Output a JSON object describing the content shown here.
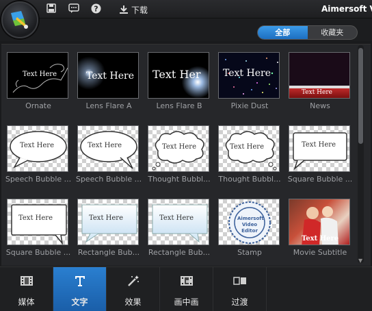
{
  "toolbar": {
    "download_label": "下载",
    "app_title": "Aimersoft V"
  },
  "filter_tabs": [
    {
      "label": "全部",
      "active": true
    },
    {
      "label": "收藏夹",
      "active": false
    }
  ],
  "templates": [
    {
      "label": "Ornate",
      "sample_text": "Text Here"
    },
    {
      "label": "Lens Flare A",
      "sample_text": "Text Here"
    },
    {
      "label": "Lens Flare B",
      "sample_text": "Text Her"
    },
    {
      "label": "Pixie Dust",
      "sample_text": "Text Here"
    },
    {
      "label": "News",
      "sample_text": "Text Here"
    },
    {
      "label": "Speech Bubble ...",
      "sample_text": "Text Here"
    },
    {
      "label": "Speech Bubble ...",
      "sample_text": "Text Here"
    },
    {
      "label": "Thought Bubbl...",
      "sample_text": "Text Here"
    },
    {
      "label": "Thought Bubbl...",
      "sample_text": "Text Here"
    },
    {
      "label": "Square Bubble ...",
      "sample_text": "Text Here"
    },
    {
      "label": "Square Bubble ...",
      "sample_text": "Text Here"
    },
    {
      "label": "Rectangle Bub...",
      "sample_text": "Text Here"
    },
    {
      "label": "Rectangle Bub...",
      "sample_text": "Text Here"
    },
    {
      "label": "Stamp",
      "sample_text": "Aimersoft Video Editor"
    },
    {
      "label": "Movie Subtitle",
      "sample_text": "Text Here"
    }
  ],
  "bottom_nav": [
    {
      "label": "媒体",
      "icon": "film-icon",
      "active": false
    },
    {
      "label": "文字",
      "icon": "text-icon",
      "active": true
    },
    {
      "label": "效果",
      "icon": "magic-wand-icon",
      "active": false
    },
    {
      "label": "画中画",
      "icon": "pip-icon",
      "active": false
    },
    {
      "label": "过渡",
      "icon": "transition-icon",
      "active": false
    }
  ],
  "colors": {
    "accent": "#2a7fd0",
    "background": "#1a1b1d",
    "panel": "#26272a"
  }
}
